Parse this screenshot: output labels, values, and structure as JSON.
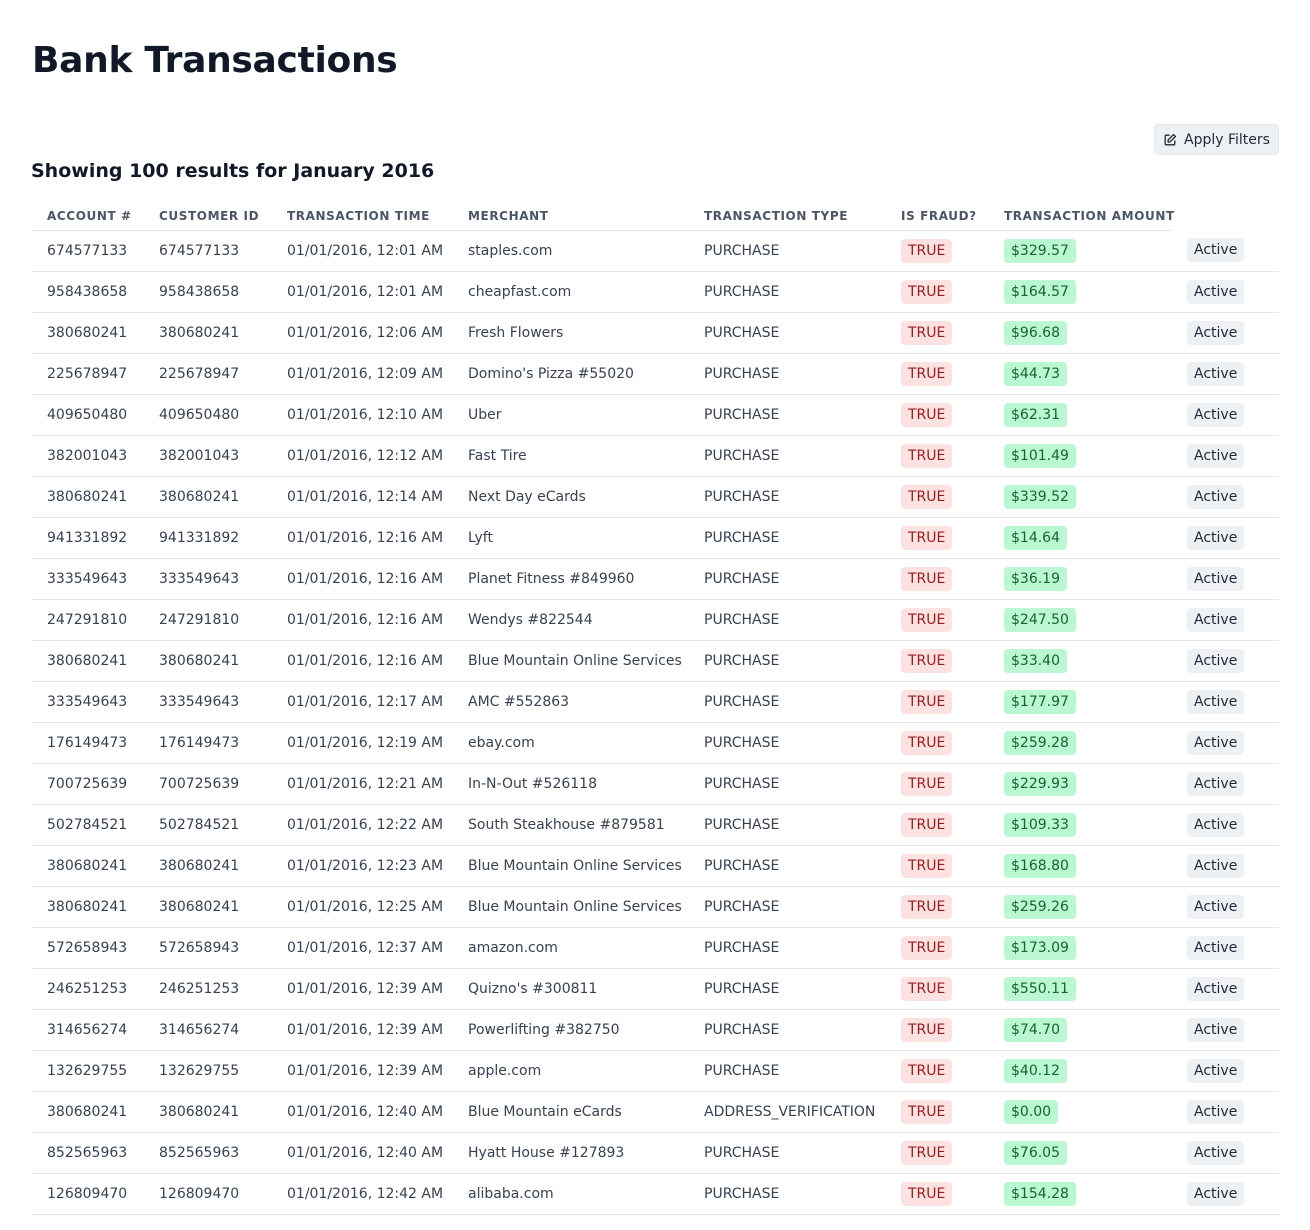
{
  "page": {
    "title": "Bank Transactions",
    "results_heading": "Showing 100 results for January 2016",
    "apply_filters_label": "Apply Filters",
    "apply_filters_icon": "edit-icon"
  },
  "colors": {
    "fraud_bg": "#fee2e2",
    "fraud_text": "#991b1b",
    "amount_bg": "#bbf7d0",
    "amount_text": "#166534",
    "status_bg": "#eef1f4"
  },
  "table": {
    "columns": [
      "ACCOUNT #",
      "CUSTOMER ID",
      "TRANSACTION TIME",
      "MERCHANT",
      "TRANSACTION TYPE",
      "IS FRAUD?",
      "TRANSACTION AMOUNT",
      ""
    ],
    "rows": [
      {
        "account": "674577133",
        "customer": "674577133",
        "time": "01/01/2016, 12:01 AM",
        "merchant": "staples.com",
        "type": "PURCHASE",
        "fraud": "TRUE",
        "amount": "$329.57",
        "status": "Active"
      },
      {
        "account": "958438658",
        "customer": "958438658",
        "time": "01/01/2016, 12:01 AM",
        "merchant": "cheapfast.com",
        "type": "PURCHASE",
        "fraud": "TRUE",
        "amount": "$164.57",
        "status": "Active"
      },
      {
        "account": "380680241",
        "customer": "380680241",
        "time": "01/01/2016, 12:06 AM",
        "merchant": "Fresh Flowers",
        "type": "PURCHASE",
        "fraud": "TRUE",
        "amount": "$96.68",
        "status": "Active"
      },
      {
        "account": "225678947",
        "customer": "225678947",
        "time": "01/01/2016, 12:09 AM",
        "merchant": "Domino's Pizza #55020",
        "type": "PURCHASE",
        "fraud": "TRUE",
        "amount": "$44.73",
        "status": "Active"
      },
      {
        "account": "409650480",
        "customer": "409650480",
        "time": "01/01/2016, 12:10 AM",
        "merchant": "Uber",
        "type": "PURCHASE",
        "fraud": "TRUE",
        "amount": "$62.31",
        "status": "Active"
      },
      {
        "account": "382001043",
        "customer": "382001043",
        "time": "01/01/2016, 12:12 AM",
        "merchant": "Fast Tire",
        "type": "PURCHASE",
        "fraud": "TRUE",
        "amount": "$101.49",
        "status": "Active"
      },
      {
        "account": "380680241",
        "customer": "380680241",
        "time": "01/01/2016, 12:14 AM",
        "merchant": "Next Day eCards",
        "type": "PURCHASE",
        "fraud": "TRUE",
        "amount": "$339.52",
        "status": "Active"
      },
      {
        "account": "941331892",
        "customer": "941331892",
        "time": "01/01/2016, 12:16 AM",
        "merchant": "Lyft",
        "type": "PURCHASE",
        "fraud": "TRUE",
        "amount": "$14.64",
        "status": "Active"
      },
      {
        "account": "333549643",
        "customer": "333549643",
        "time": "01/01/2016, 12:16 AM",
        "merchant": "Planet Fitness #849960",
        "type": "PURCHASE",
        "fraud": "TRUE",
        "amount": "$36.19",
        "status": "Active"
      },
      {
        "account": "247291810",
        "customer": "247291810",
        "time": "01/01/2016, 12:16 AM",
        "merchant": "Wendys #822544",
        "type": "PURCHASE",
        "fraud": "TRUE",
        "amount": "$247.50",
        "status": "Active"
      },
      {
        "account": "380680241",
        "customer": "380680241",
        "time": "01/01/2016, 12:16 AM",
        "merchant": "Blue Mountain Online Services",
        "type": "PURCHASE",
        "fraud": "TRUE",
        "amount": "$33.40",
        "status": "Active"
      },
      {
        "account": "333549643",
        "customer": "333549643",
        "time": "01/01/2016, 12:17 AM",
        "merchant": "AMC #552863",
        "type": "PURCHASE",
        "fraud": "TRUE",
        "amount": "$177.97",
        "status": "Active"
      },
      {
        "account": "176149473",
        "customer": "176149473",
        "time": "01/01/2016, 12:19 AM",
        "merchant": "ebay.com",
        "type": "PURCHASE",
        "fraud": "TRUE",
        "amount": "$259.28",
        "status": "Active"
      },
      {
        "account": "700725639",
        "customer": "700725639",
        "time": "01/01/2016, 12:21 AM",
        "merchant": "In-N-Out #526118",
        "type": "PURCHASE",
        "fraud": "TRUE",
        "amount": "$229.93",
        "status": "Active"
      },
      {
        "account": "502784521",
        "customer": "502784521",
        "time": "01/01/2016, 12:22 AM",
        "merchant": "South Steakhouse #879581",
        "type": "PURCHASE",
        "fraud": "TRUE",
        "amount": "$109.33",
        "status": "Active"
      },
      {
        "account": "380680241",
        "customer": "380680241",
        "time": "01/01/2016, 12:23 AM",
        "merchant": "Blue Mountain Online Services",
        "type": "PURCHASE",
        "fraud": "TRUE",
        "amount": "$168.80",
        "status": "Active"
      },
      {
        "account": "380680241",
        "customer": "380680241",
        "time": "01/01/2016, 12:25 AM",
        "merchant": "Blue Mountain Online Services",
        "type": "PURCHASE",
        "fraud": "TRUE",
        "amount": "$259.26",
        "status": "Active"
      },
      {
        "account": "572658943",
        "customer": "572658943",
        "time": "01/01/2016, 12:37 AM",
        "merchant": "amazon.com",
        "type": "PURCHASE",
        "fraud": "TRUE",
        "amount": "$173.09",
        "status": "Active"
      },
      {
        "account": "246251253",
        "customer": "246251253",
        "time": "01/01/2016, 12:39 AM",
        "merchant": "Quizno's #300811",
        "type": "PURCHASE",
        "fraud": "TRUE",
        "amount": "$550.11",
        "status": "Active"
      },
      {
        "account": "314656274",
        "customer": "314656274",
        "time": "01/01/2016, 12:39 AM",
        "merchant": "Powerlifting #382750",
        "type": "PURCHASE",
        "fraud": "TRUE",
        "amount": "$74.70",
        "status": "Active"
      },
      {
        "account": "132629755",
        "customer": "132629755",
        "time": "01/01/2016, 12:39 AM",
        "merchant": "apple.com",
        "type": "PURCHASE",
        "fraud": "TRUE",
        "amount": "$40.12",
        "status": "Active"
      },
      {
        "account": "380680241",
        "customer": "380680241",
        "time": "01/01/2016, 12:40 AM",
        "merchant": "Blue Mountain eCards",
        "type": "ADDRESS_VERIFICATION",
        "fraud": "TRUE",
        "amount": "$0.00",
        "status": "Active"
      },
      {
        "account": "852565963",
        "customer": "852565963",
        "time": "01/01/2016, 12:40 AM",
        "merchant": "Hyatt House #127893",
        "type": "PURCHASE",
        "fraud": "TRUE",
        "amount": "$76.05",
        "status": "Active"
      },
      {
        "account": "126809470",
        "customer": "126809470",
        "time": "01/01/2016, 12:42 AM",
        "merchant": "alibaba.com",
        "type": "PURCHASE",
        "fraud": "TRUE",
        "amount": "$154.28",
        "status": "Active"
      }
    ]
  }
}
